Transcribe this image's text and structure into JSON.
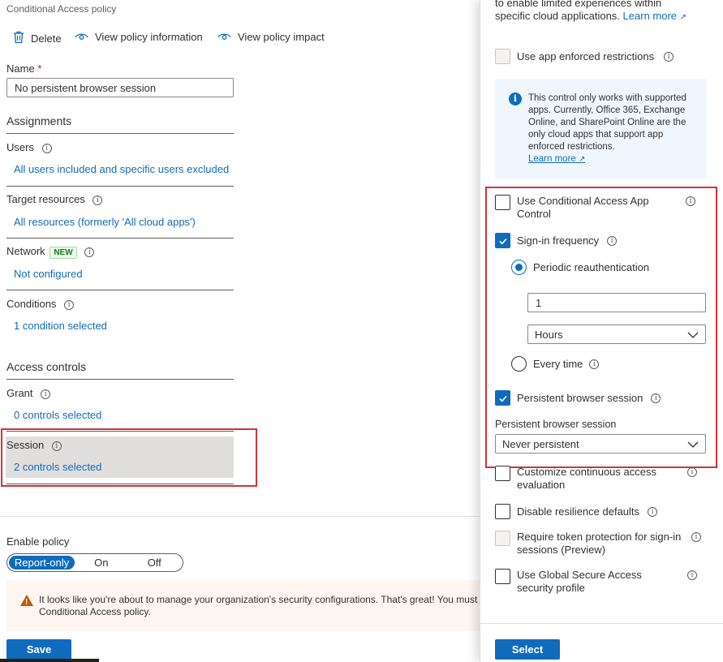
{
  "header": {
    "subtitle": "Conditional Access policy"
  },
  "toolbar": {
    "delete_label": "Delete",
    "view_info_label": "View policy information",
    "view_impact_label": "View policy impact"
  },
  "name_field": {
    "label": "Name",
    "required_mark": "*",
    "value": "No persistent browser session"
  },
  "assignments": {
    "heading": "Assignments",
    "users": {
      "label": "Users",
      "value": "All users included and specific users excluded"
    },
    "target_resources": {
      "label": "Target resources",
      "value": "All resources (formerly 'All cloud apps')"
    },
    "network": {
      "label": "Network",
      "badge": "NEW",
      "value": "Not configured"
    },
    "conditions": {
      "label": "Conditions",
      "value": "1 condition selected"
    }
  },
  "access_controls": {
    "heading": "Access controls",
    "grant": {
      "label": "Grant",
      "value": "0 controls selected"
    },
    "session": {
      "label": "Session",
      "value": "2 controls selected"
    }
  },
  "enable_policy": {
    "label": "Enable policy",
    "options": [
      "Report-only",
      "On",
      "Off"
    ],
    "selected": "Report-only"
  },
  "warning": {
    "line1": "It looks like you're about to manage your organization's security configurations. That's great! You must",
    "line2": "Conditional Access policy."
  },
  "save_button": "Save",
  "session_panel": {
    "top_text_line1": "to enable limited experiences within",
    "top_text_line2": "specific cloud applications.",
    "learn_more": "Learn more",
    "app_enforced": {
      "label": "Use app enforced restrictions",
      "checked": false
    },
    "info_box": {
      "text": "This control only works with supported apps. Currently, Office 365, Exchange Online, and SharePoint Online are the only cloud apps that support app enforced restrictions.",
      "link": "Learn more"
    },
    "app_control": {
      "label": "Use Conditional Access App Control",
      "checked": false
    },
    "signin_frequency": {
      "label": "Sign-in frequency",
      "checked": true,
      "periodic_label": "Periodic reauthentication",
      "value": "1",
      "unit": "Hours",
      "every_time_label": "Every time"
    },
    "persistent_session": {
      "label": "Persistent browser session",
      "checked": true,
      "dropdown_label": "Persistent browser session",
      "dropdown_value": "Never persistent"
    },
    "cae": {
      "label": "Customize continuous access evaluation",
      "checked": false
    },
    "resilience": {
      "label": "Disable resilience defaults",
      "checked": false
    },
    "token_protection": {
      "label": "Require token protection for sign-in sessions (Preview)",
      "checked": false
    },
    "global_secure_access": {
      "label": "Use Global Secure Access security profile",
      "checked": false
    },
    "select_button": "Select"
  },
  "colors": {
    "accent": "#0f6cbd",
    "highlight_border": "#d13438",
    "warning": "#c25700",
    "badge_green": "#107c10"
  }
}
